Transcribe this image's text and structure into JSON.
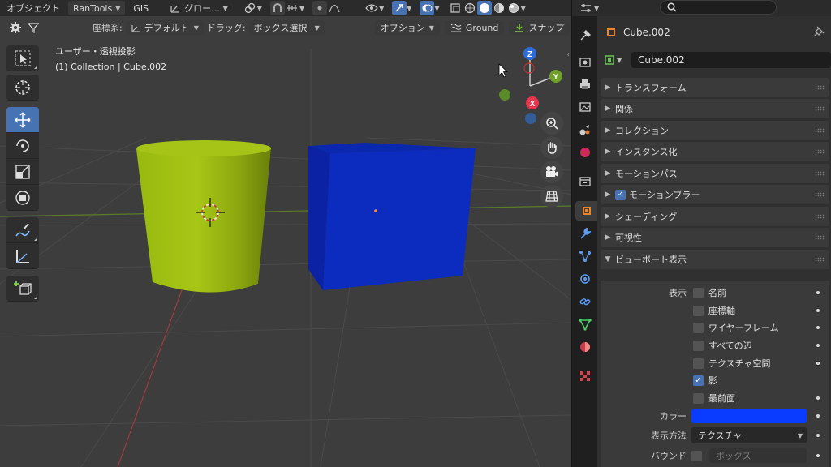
{
  "header": {
    "mode": "オブジェクト",
    "addons": [
      "RanTools",
      "GIS"
    ],
    "transform_orientation": "グロー...",
    "colors": {
      "accent": "#4772b3",
      "bg": "#3d3d3d"
    }
  },
  "right_header": {
    "editor_icon": "properties-icon",
    "search_placeholder": ""
  },
  "viewport": {
    "tool_settings": {
      "coord_label": "座標系:",
      "coord_value": "デフォルト",
      "drag_label": "ドラッグ:",
      "drag_value": "ボックス選択",
      "options_label": "オプション",
      "ground_label": "Ground",
      "snap_label": "スナップ"
    },
    "view_name": "ユーザー・透視投影",
    "collection_info": "(1) Collection | Cube.002",
    "gizmo": {
      "z": "Z",
      "y": "Y",
      "x": "X"
    },
    "objects": {
      "cylinder_color": "#a4c214",
      "cube_color": "#0b29b8"
    }
  },
  "properties": {
    "object_name": "Cube.002",
    "data_name": "Cube.002",
    "panels": [
      {
        "label": "トランスフォーム"
      },
      {
        "label": "関係"
      },
      {
        "label": "コレクション"
      },
      {
        "label": "インスタンス化"
      },
      {
        "label": "モーションパス"
      },
      {
        "label": "モーションブラー",
        "checked": true
      },
      {
        "label": "シェーディング"
      },
      {
        "label": "可視性"
      }
    ],
    "viewport_display": {
      "title": "ビューポート表示",
      "show_label": "表示",
      "checkboxes": [
        {
          "label": "名前",
          "checked": false
        },
        {
          "label": "座標軸",
          "checked": false
        },
        {
          "label": "ワイヤーフレーム",
          "checked": false
        },
        {
          "label": "すべての辺",
          "checked": false
        },
        {
          "label": "テクスチャ空間",
          "checked": false
        },
        {
          "label": "影",
          "checked": true
        },
        {
          "label": "最前面",
          "checked": false
        }
      ],
      "color_label": "カラー",
      "color_value": "#0a3cff",
      "display_as_label": "表示方法",
      "display_as_value": "テクスチャ",
      "bounds_label": "バウンド",
      "bounds_value": "ボックス"
    }
  }
}
